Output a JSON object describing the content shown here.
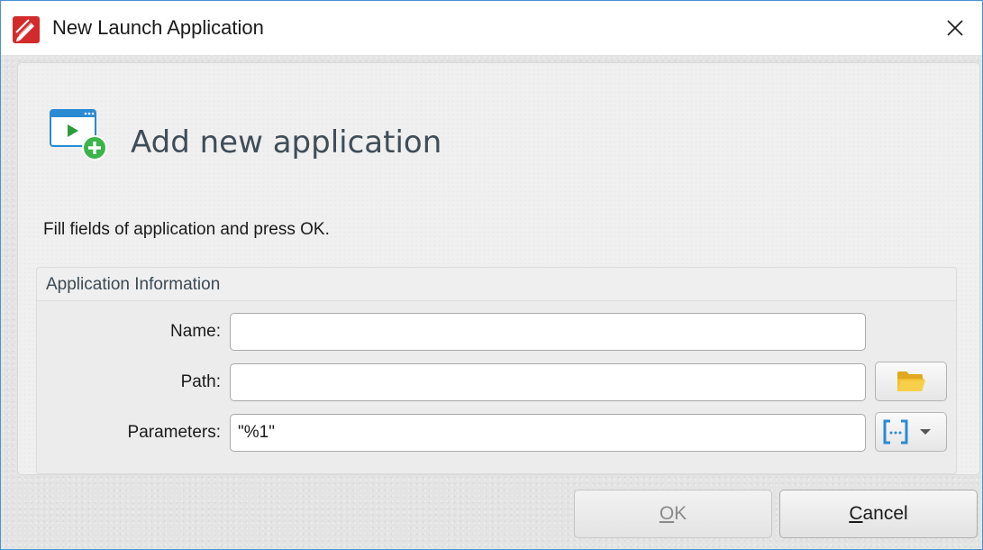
{
  "window": {
    "title": "New Launch Application",
    "app_icon": "pdf-pen-icon",
    "close_icon": "close-icon"
  },
  "header": {
    "icon": "application-add-icon",
    "title": "Add new application"
  },
  "instruction": "Fill fields of application and press OK.",
  "group": {
    "title": "Application Information",
    "fields": {
      "name": {
        "label": "Name:",
        "value": ""
      },
      "path": {
        "label": "Path:",
        "value": "",
        "browse_icon": "folder-icon"
      },
      "parameters": {
        "label": "Parameters:",
        "value": "\"%1\"",
        "macro_icon": "macro-brackets-icon",
        "dropdown_icon": "chevron-down-icon"
      }
    }
  },
  "buttons": {
    "ok": {
      "mnemonic": "O",
      "rest": "K",
      "enabled": false
    },
    "cancel": {
      "mnemonic": "C",
      "rest": "ancel",
      "enabled": true
    }
  },
  "colors": {
    "window_border": "#4a90d9",
    "header_title": "#3f4d57",
    "accent_blue": "#2a8ad4",
    "folder_yellow": "#f2c12e",
    "add_green": "#3cb44a"
  }
}
